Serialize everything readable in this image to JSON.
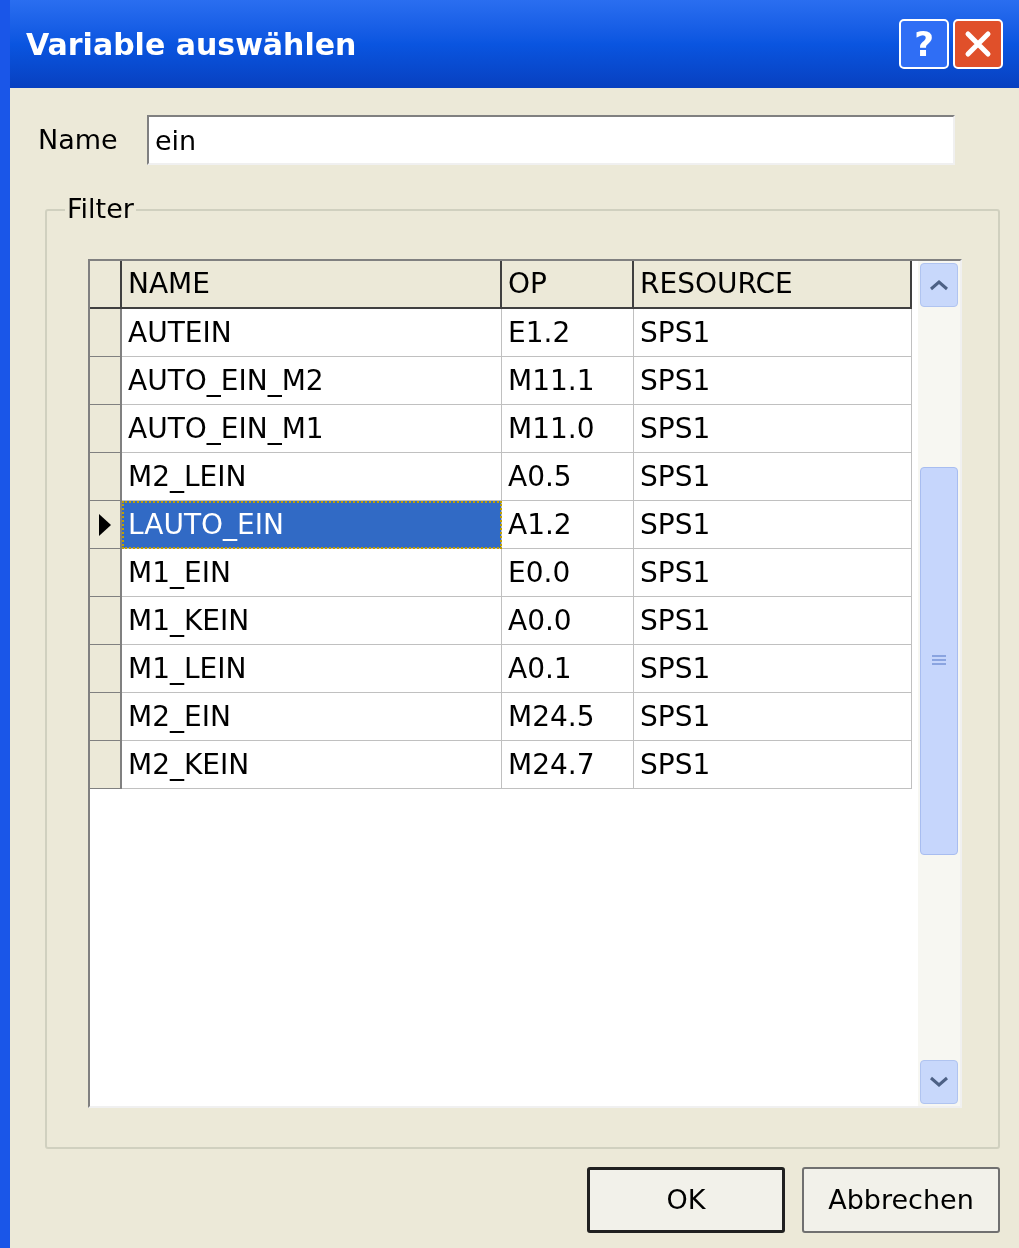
{
  "window": {
    "title": "Variable auswählen",
    "help_glyph": "?"
  },
  "name_field": {
    "label": "Name",
    "value": "ein"
  },
  "filter": {
    "legend": "Filter"
  },
  "table": {
    "columns": [
      "NAME",
      "OP",
      "RESOURCE"
    ],
    "rows": [
      {
        "name": "AUTEIN",
        "op": "E1.2",
        "resource": "SPS1",
        "selected": false
      },
      {
        "name": "AUTO_EIN_M2",
        "op": "M11.1",
        "resource": "SPS1",
        "selected": false
      },
      {
        "name": "AUTO_EIN_M1",
        "op": "M11.0",
        "resource": "SPS1",
        "selected": false
      },
      {
        "name": "M2_LEIN",
        "op": "A0.5",
        "resource": "SPS1",
        "selected": false
      },
      {
        "name": "LAUTO_EIN",
        "op": "A1.2",
        "resource": "SPS1",
        "selected": true
      },
      {
        "name": "M1_EIN",
        "op": "E0.0",
        "resource": "SPS1",
        "selected": false
      },
      {
        "name": "M1_KEIN",
        "op": "A0.0",
        "resource": "SPS1",
        "selected": false
      },
      {
        "name": "M1_LEIN",
        "op": "A0.1",
        "resource": "SPS1",
        "selected": false
      },
      {
        "name": "M2_EIN",
        "op": "M24.5",
        "resource": "SPS1",
        "selected": false
      },
      {
        "name": "M2_KEIN",
        "op": "M24.7",
        "resource": "SPS1",
        "selected": false
      }
    ]
  },
  "buttons": [
    "OK",
    "Abbrechen"
  ]
}
